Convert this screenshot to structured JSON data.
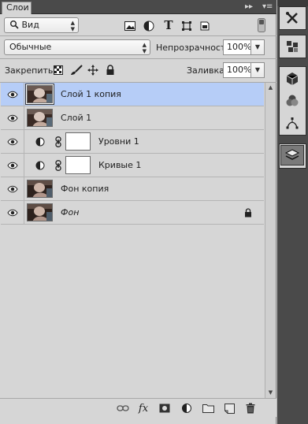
{
  "panel": {
    "tab_title": "Слои",
    "collapse_glyph": "▸▸",
    "menu_glyph": "▾≡"
  },
  "filter": {
    "kind_label": "Вид"
  },
  "blend": {
    "mode": "Обычные",
    "opacity_label": "Непрозрачность:",
    "opacity_value": "100%"
  },
  "lock": {
    "label": "Закрепить:",
    "fill_label": "Заливка:",
    "fill_value": "100%"
  },
  "layers": [
    {
      "name": "Слой 1 копия",
      "type": "photo",
      "selected": true,
      "italic": false,
      "locked": false
    },
    {
      "name": "Слой 1",
      "type": "photo",
      "selected": false,
      "italic": false,
      "locked": false
    },
    {
      "name": "Уровни 1",
      "type": "adjustment",
      "selected": false,
      "italic": false,
      "locked": false
    },
    {
      "name": "Кривые 1",
      "type": "adjustment",
      "selected": false,
      "italic": false,
      "locked": false
    },
    {
      "name": "Фон копия",
      "type": "photo",
      "selected": false,
      "italic": false,
      "locked": false
    },
    {
      "name": "Фон",
      "type": "photo",
      "selected": false,
      "italic": true,
      "locked": true
    }
  ],
  "bottom_icons": [
    "link-icon",
    "fx-icon",
    "add-mask-icon",
    "adjustment-layer-icon",
    "new-group-icon",
    "new-layer-icon",
    "trash-icon"
  ],
  "bottom": {
    "fx_label": "fx"
  },
  "dock_icons": [
    "tools-icon",
    "3d-cubes-icon",
    "3d-icon",
    "channels-icon",
    "paths-icon",
    "layers-icon"
  ],
  "colors": {
    "panel_bg": "#d6d6d6",
    "selected_layer": "#b6cdf7",
    "dark_chrome": "#4a4a4a"
  }
}
